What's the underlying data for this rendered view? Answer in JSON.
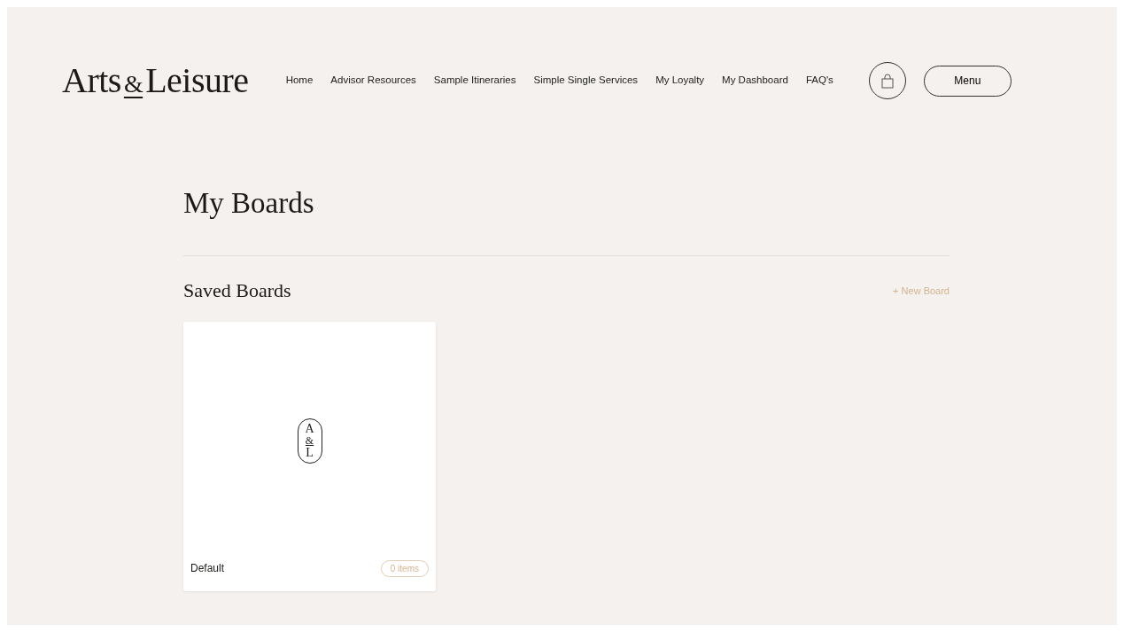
{
  "header": {
    "logo": {
      "left": "Arts",
      "amp": "&",
      "right": "Leisure"
    },
    "nav": [
      "Home",
      "Advisor Resources",
      "Sample Itineraries",
      "Simple Single Services",
      "My Loyalty",
      "My Dashboard",
      "FAQ's"
    ],
    "menu_button": "Menu"
  },
  "page_title": "My Boards",
  "section": {
    "title": "Saved Boards",
    "new_board": "+ New Board"
  },
  "boards": [
    {
      "emblem": [
        "A",
        "&",
        "L"
      ],
      "name": "Default",
      "count": "0 items"
    }
  ]
}
